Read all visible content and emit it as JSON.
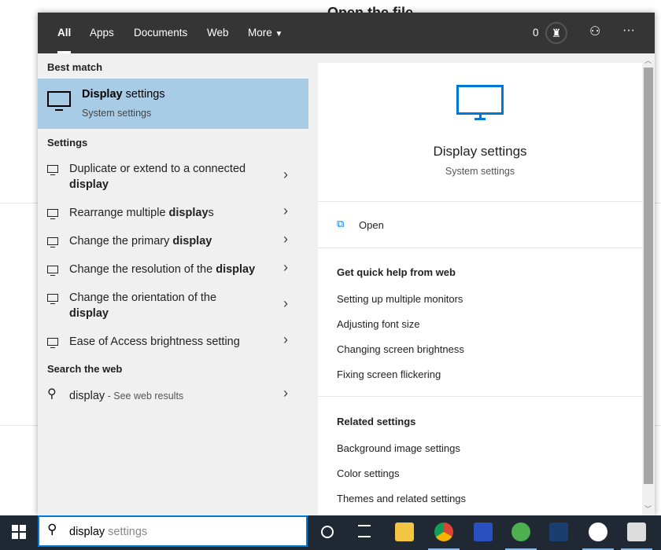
{
  "background": {
    "title": "Open the file"
  },
  "header": {
    "tabs": [
      {
        "label": "All",
        "active": true
      },
      {
        "label": "Apps"
      },
      {
        "label": "Documents"
      },
      {
        "label": "Web"
      },
      {
        "label": "More"
      }
    ],
    "points": "0",
    "icons": [
      "trophy-icon",
      "feedback-icon",
      "more-icon"
    ]
  },
  "best_match": {
    "heading": "Best match",
    "title_bold": "Display",
    "title_rest": " settings",
    "subtitle": "System settings"
  },
  "settings": {
    "heading": "Settings",
    "items": [
      {
        "pre": "Duplicate or extend to a connected ",
        "bold": "display",
        "post": ""
      },
      {
        "pre": "Rearrange multiple ",
        "bold": "display",
        "post": "s"
      },
      {
        "pre": "Change the primary ",
        "bold": "display",
        "post": ""
      },
      {
        "pre": "Change the resolution of the ",
        "bold": "display",
        "post": ""
      },
      {
        "pre": "Change the orientation of the ",
        "bold": "display",
        "post": ""
      },
      {
        "pre": "Ease of Access brightness setting",
        "bold": "",
        "post": ""
      }
    ]
  },
  "web": {
    "heading": "Search the web",
    "query": "display",
    "suffix": " - See web results"
  },
  "preview": {
    "title": "Display settings",
    "subtitle": "System settings",
    "open": "Open",
    "help_heading": "Get quick help from web",
    "help": [
      "Setting up multiple monitors",
      "Adjusting font size",
      "Changing screen brightness",
      "Fixing screen flickering"
    ],
    "related_heading": "Related settings",
    "related": [
      "Background image settings",
      "Color settings",
      "Themes and related settings"
    ]
  },
  "search": {
    "typed": "display",
    "suggest": " settings"
  },
  "accent": "#0078d7"
}
